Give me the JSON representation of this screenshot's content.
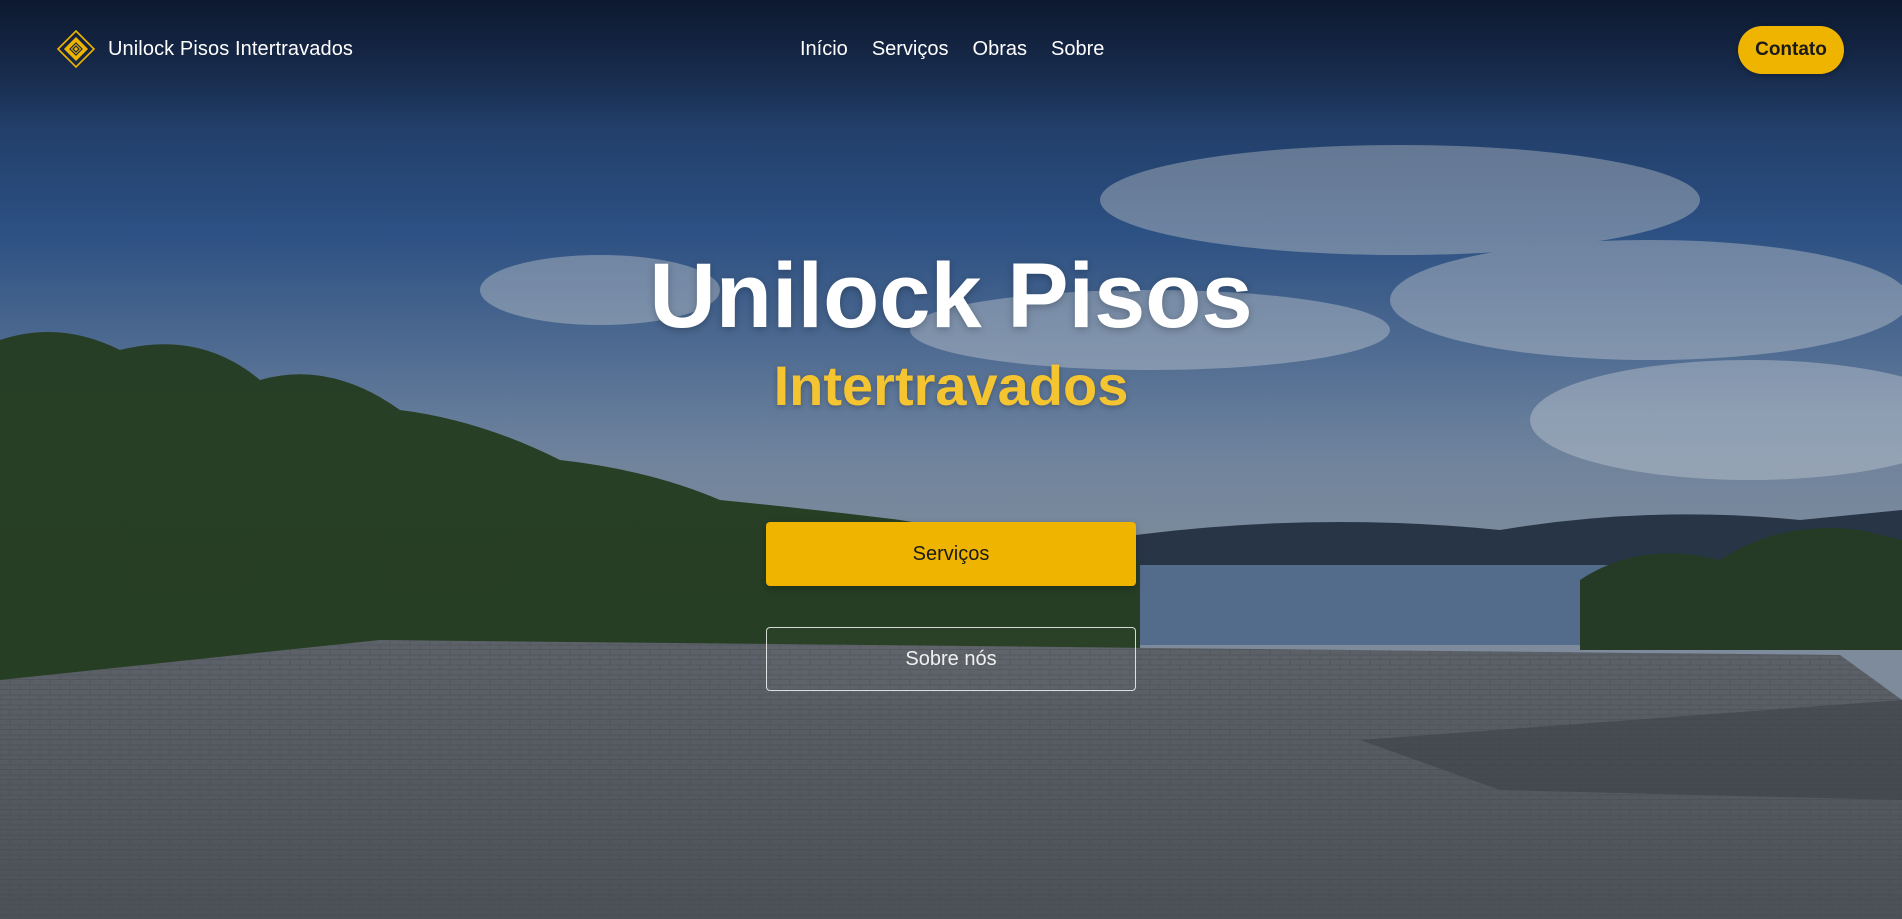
{
  "brand": {
    "name": "Unilock Pisos Intertravados",
    "icon": "diamond-paver-logo-icon",
    "color": "#efb400"
  },
  "nav": {
    "items": [
      {
        "label": "Início"
      },
      {
        "label": "Serviços"
      },
      {
        "label": "Obras"
      },
      {
        "label": "Sobre"
      }
    ]
  },
  "header": {
    "contact_label": "Contato"
  },
  "hero": {
    "title": "Unilock Pisos",
    "subtitle": "Intertravados",
    "primary_button": "Serviços",
    "secondary_button": "Sobre nós"
  },
  "colors": {
    "accent": "#efb400",
    "subtitle": "#f4c431",
    "text": "#ffffff"
  }
}
